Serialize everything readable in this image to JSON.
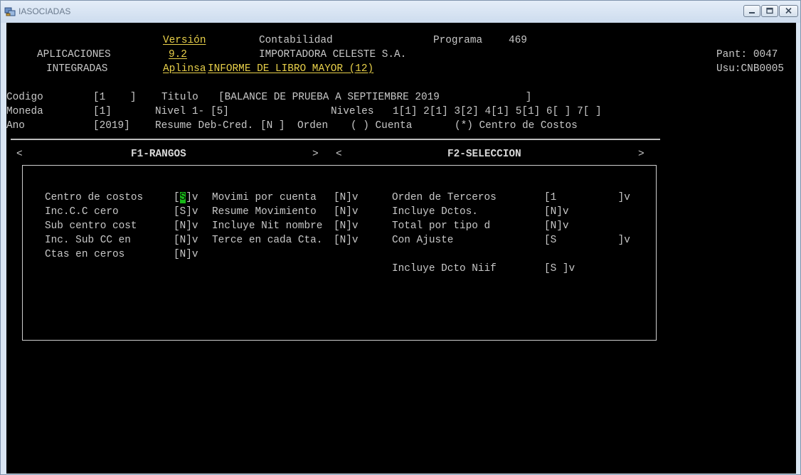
{
  "window": {
    "title": "IASOCIADAS"
  },
  "header": {
    "version_label": "Versión",
    "version_value": "9.2",
    "vendor": "Aplinsa",
    "apps_line1": "APLICACIONES",
    "apps_line2": "INTEGRADAS",
    "module": "Contabilidad",
    "program_label": "Programa",
    "program_number": "469",
    "company": "IMPORTADORA CELESTE S.A.",
    "report": "INFORME DE LIBRO MAYOR (12)",
    "pant": "Pant: 0047",
    "usu": "Usu:CNB0005"
  },
  "params": {
    "codigo_label": "Codigo",
    "codigo_value": "[1    ]",
    "titulo_label": "Titulo",
    "titulo_value": "[BALANCE DE PRUEBA A SEPTIEMBRE 2019              ]",
    "moneda_label": "Moneda",
    "moneda_value": "[1]",
    "nivel_label": "Nivel 1-",
    "nivel_value": "[5]",
    "niveles_label": "Niveles",
    "niveles_value": "1[1] 2[1] 3[2] 4[1] 5[1] 6[ ] 7[ ]",
    "ano_label": "Ano",
    "ano_value": "[2019]",
    "resume_label": "Resume Deb-Cred.",
    "resume_value": "[N ]",
    "orden_label": "Orden",
    "orden_cuenta": "( ) Cuenta",
    "orden_centro": "(*) Centro de Costos"
  },
  "tabs": {
    "f1_left": "<",
    "f1": "F1-RANGOS",
    "f1_right": ">",
    "f2_left": "<",
    "f2": "F2-SELECCION",
    "f2_right": ">"
  },
  "options": {
    "o1_label": "Centro de costos",
    "o1_pre": "[",
    "o1_val": "S",
    "o1_post": "]v",
    "o2_label": "Inc.C.C cero",
    "o2_val": "[S]v",
    "o3_label": "Sub centro cost",
    "o3_val": "[N]v",
    "o4_label": "Inc. Sub CC en",
    "o4_val": "[N]v",
    "o5_label": "Ctas en ceros",
    "o5_val": "[N]v",
    "m1_label": "Movimi por cuenta",
    "m1_val": "[N]v",
    "m2_label": "Resume Movimiento",
    "m2_val": "[N]v",
    "m3_label": "Incluye Nit nombre",
    "m3_val": "[N]v",
    "m4_label": "Terce en cada Cta.",
    "m4_val": "[N]v",
    "r1_label": "Orden de Terceros",
    "r1_val": "[1          ]v",
    "r2_label": "Incluye Dctos.",
    "r2_val": "[N]v",
    "r3_label": "Total por tipo d",
    "r3_val": "[N]v",
    "r4_label": "Con Ajuste",
    "r4_val": "[S          ]v",
    "r5_label": "Incluye Dcto Niif",
    "r5_val": "[S ]v"
  }
}
